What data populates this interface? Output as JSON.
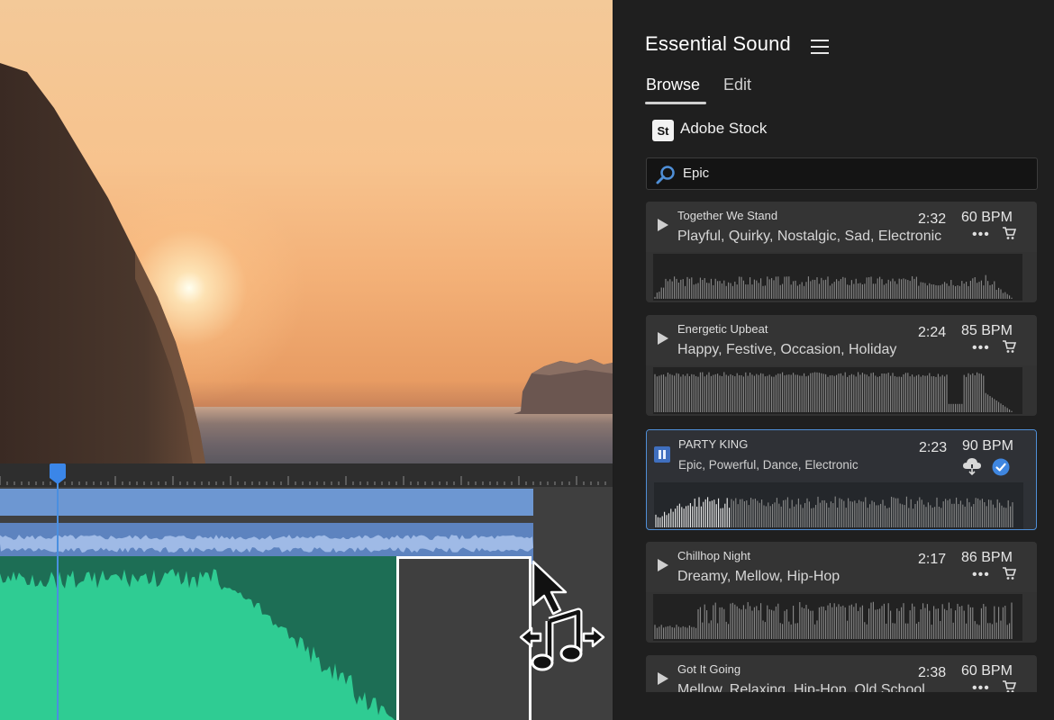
{
  "panel": {
    "title": "Essential Sound",
    "tabs": [
      {
        "label": "Browse",
        "active": true
      },
      {
        "label": "Edit",
        "active": false
      }
    ],
    "source": {
      "logo": "St",
      "label": "Adobe Stock"
    },
    "search": {
      "value": "Epic",
      "icon": "search-icon"
    }
  },
  "tracks": [
    {
      "title": "Together We Stand",
      "tags": "Playful, Quirky, Nostalgic, Sad, Electronic",
      "duration": "2:32",
      "bpm": "60 BPM",
      "state": "idle",
      "more": "•••"
    },
    {
      "title": "Energetic Upbeat",
      "tags": "Happy, Festive, Occasion, Holiday",
      "duration": "2:24",
      "bpm": "85 BPM",
      "state": "idle",
      "more": "•••"
    },
    {
      "title": "PARTY KING",
      "tags": "Epic, Powerful, Dance, Electronic",
      "duration": "2:23",
      "bpm": "90 BPM",
      "state": "playing",
      "licensed": true
    },
    {
      "title": "Chillhop Night",
      "tags": "Dreamy, Mellow, Hip-Hop",
      "duration": "2:17",
      "bpm": "86 BPM",
      "state": "idle",
      "more": "•••"
    },
    {
      "title": "Got It Going",
      "tags": "Mellow, Relaxing, Hip-Hop, Old School",
      "duration": "2:38",
      "bpm": "60 BPM",
      "state": "idle",
      "more": "•••"
    }
  ],
  "colors": {
    "accent": "#4f8fd7",
    "video_track": "#6d97d2",
    "audio_track": "#5d83bf",
    "music_clip": "#2ecc94",
    "panel_bg": "#1f1f1f"
  }
}
